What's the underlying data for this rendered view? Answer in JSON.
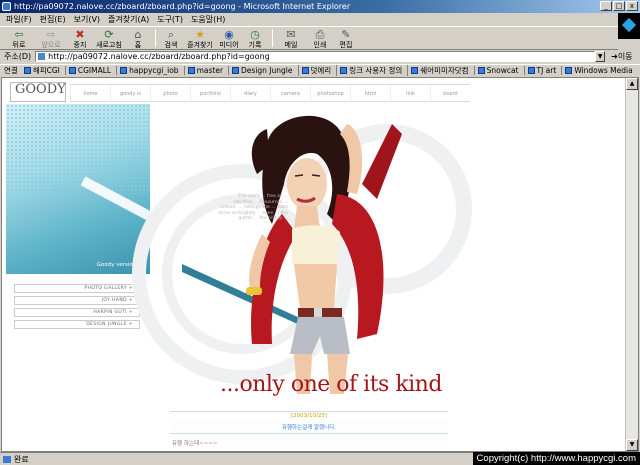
{
  "window": {
    "title": "http://pa09072.nalove.cc/zboard/zboard.php?id=goong - Microsoft Internet Explorer",
    "buttons": [
      "_",
      "□",
      "x"
    ]
  },
  "menu": [
    "파일(F)",
    "편집(E)",
    "보기(V)",
    "즐겨찾기(A)",
    "도구(T)",
    "도움말(H)"
  ],
  "toolbar": {
    "back": "뒤로",
    "forward": "앞으로",
    "stop": "중지",
    "refresh": "새로고침",
    "home": "홈",
    "search": "검색",
    "favorites": "즐겨찾기",
    "media": "미디어",
    "history": "기록",
    "mail": "메일",
    "print": "인쇄",
    "edit": "편집"
  },
  "address": {
    "label": "주소(D)",
    "url": "http://pa09072.nalove.cc/zboard/zboard.php?id=goong",
    "go": "이동"
  },
  "links": {
    "label": "연결",
    "items": [
      "해피CGI",
      "CGIMALL",
      "happycgi_iob",
      "master",
      "Design Jungle",
      "덧에리",
      "링크 사용자 정의",
      "쉐어미미자닷컴",
      "Snowcat",
      "TJ art",
      "Windows Media"
    ]
  },
  "site": {
    "logo": "GOODY",
    "logo_sub": "GOODDESIGN GOODY",
    "nav": [
      "home",
      "goody is",
      "photo",
      "portfolio",
      "diary",
      "camera",
      "photoshop",
      "html",
      "link",
      "board"
    ],
    "version": "Goody version_04",
    "side_menu": [
      "PHOTO GALLERY  +",
      "JOY HAND  +",
      "HARPIN GUTI  +",
      "DESIGN JUNGLE  +"
    ],
    "overlay_text": "The sun's ... free as ... satisfied ... Resources ... indeed, ... lettings the ... stars shine so brightly ... seen ... the gutter ... the hilltop ... ",
    "tagline": "...only one of its kind",
    "date": "[2003/10/23]",
    "post_title": "유행하는걸게 알했니다.",
    "comment": "유행 하는데~~~~"
  },
  "status": {
    "text": "완료",
    "copyright": "Copyright(c) http://www.happycgi.com"
  },
  "colors": {
    "titlebar": "#0a246a",
    "chrome": "#d4d0c8",
    "jacket_red": "#b81820",
    "cyan_panel": "#5eb4c9",
    "tagline": "#a3161a"
  }
}
